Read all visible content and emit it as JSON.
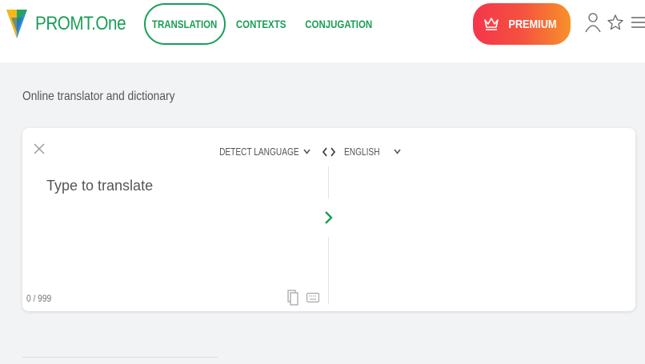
{
  "header": {
    "brand": "PROMT.One",
    "tabs": [
      {
        "label": "TRANSLATION",
        "active": true
      },
      {
        "label": "CONTEXTS",
        "active": false
      },
      {
        "label": "CONJUGATION",
        "active": false
      }
    ],
    "premium_label": "PREMIUM",
    "icons": [
      "user-icon",
      "star-icon",
      "menu-icon"
    ]
  },
  "main": {
    "subtitle": "Online translator and dictionary",
    "source_language": "DETECT LANGUAGE",
    "target_language": "ENGLISH",
    "input_placeholder": "Type to translate",
    "input_value": "",
    "char_counter": "0 / 999"
  },
  "colors": {
    "brand_green": "#1a9e56",
    "premium_gradient_start": "#f4364c",
    "premium_gradient_end": "#f7922a",
    "page_background": "#f2f3f5"
  }
}
